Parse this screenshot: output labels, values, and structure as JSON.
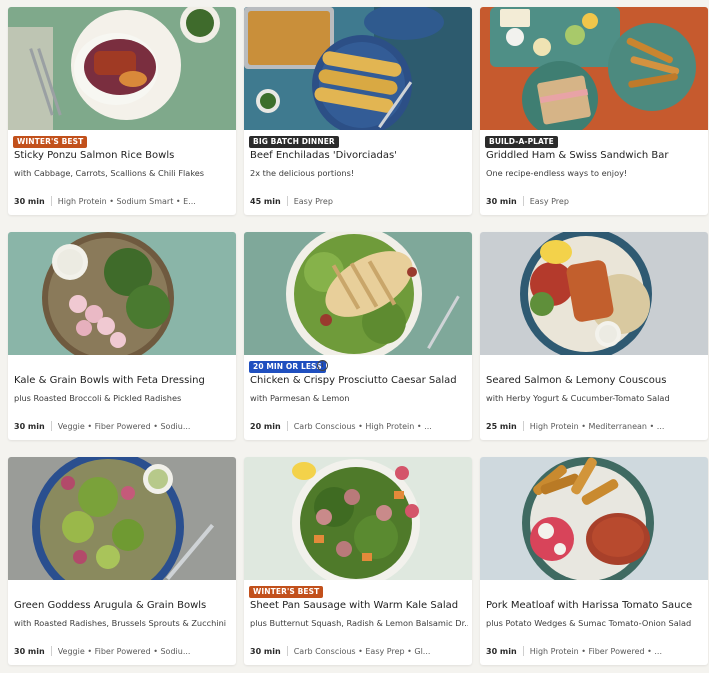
{
  "recipes": [
    {
      "badge": "WINTER'S BEST",
      "badge_color": "#c2501b",
      "title": "Sticky Ponzu Salmon Rice Bowls",
      "subtitle": "with Cabbage, Carrots, Scallions & Chili Flakes",
      "time": "30 min",
      "tags": "High Protein • Sodium Smart • E..."
    },
    {
      "badge": "BIG BATCH DINNER",
      "badge_color": "#2b2b2b",
      "title": "Beef Enchiladas 'Divorciadas'",
      "subtitle": "2x the delicious portions!",
      "time": "45 min",
      "tags": "Easy Prep"
    },
    {
      "badge": "BUILD-A-PLATE",
      "badge_color": "#2b2b2b",
      "title": "Griddled Ham & Swiss Sandwich Bar",
      "subtitle": "One recipe-endless ways to enjoy!",
      "time": "30 min",
      "tags": "Easy Prep"
    },
    {
      "badge": "",
      "title": "Kale & Grain Bowls with Feta Dressing",
      "subtitle": "plus Roasted Broccoli & Pickled Radishes",
      "time": "30 min",
      "tags": "Veggie • Fiber Powered • Sodiu..."
    },
    {
      "badge": "20 MIN OR LESS",
      "badge_color": "#1f4fbf",
      "info_icon": "i",
      "title": "Chicken & Crispy Prosciutto Caesar Salad",
      "subtitle": "with Parmesan & Lemon",
      "time": "20 min",
      "tags": "Carb Conscious • High Protein • ..."
    },
    {
      "badge": "",
      "title": "Seared Salmon & Lemony Couscous",
      "subtitle": "with Herby Yogurt & Cucumber-Tomato Salad",
      "time": "25 min",
      "tags": "High Protein • Mediterranean • ..."
    },
    {
      "badge": "",
      "title": "Green Goddess Arugula & Grain Bowls",
      "subtitle": "with Roasted Radishes, Brussels Sprouts & Zucchini",
      "time": "30 min",
      "tags": "Veggie • Fiber Powered • Sodiu..."
    },
    {
      "badge": "WINTER'S BEST",
      "badge_color": "#c2501b",
      "title": "Sheet Pan Sausage with Warm Kale Salad",
      "subtitle": "plus Butternut Squash, Radish & Lemon Balsamic Dr...",
      "time": "30 min",
      "tags": "Carb Conscious • Easy Prep • Gl..."
    },
    {
      "badge": "",
      "title": "Pork Meatloaf with Harissa Tomato Sauce",
      "subtitle": "plus Potato Wedges & Sumac Tomato-Onion Salad",
      "time": "30 min",
      "tags": "High Protein • Fiber Powered • ..."
    }
  ]
}
